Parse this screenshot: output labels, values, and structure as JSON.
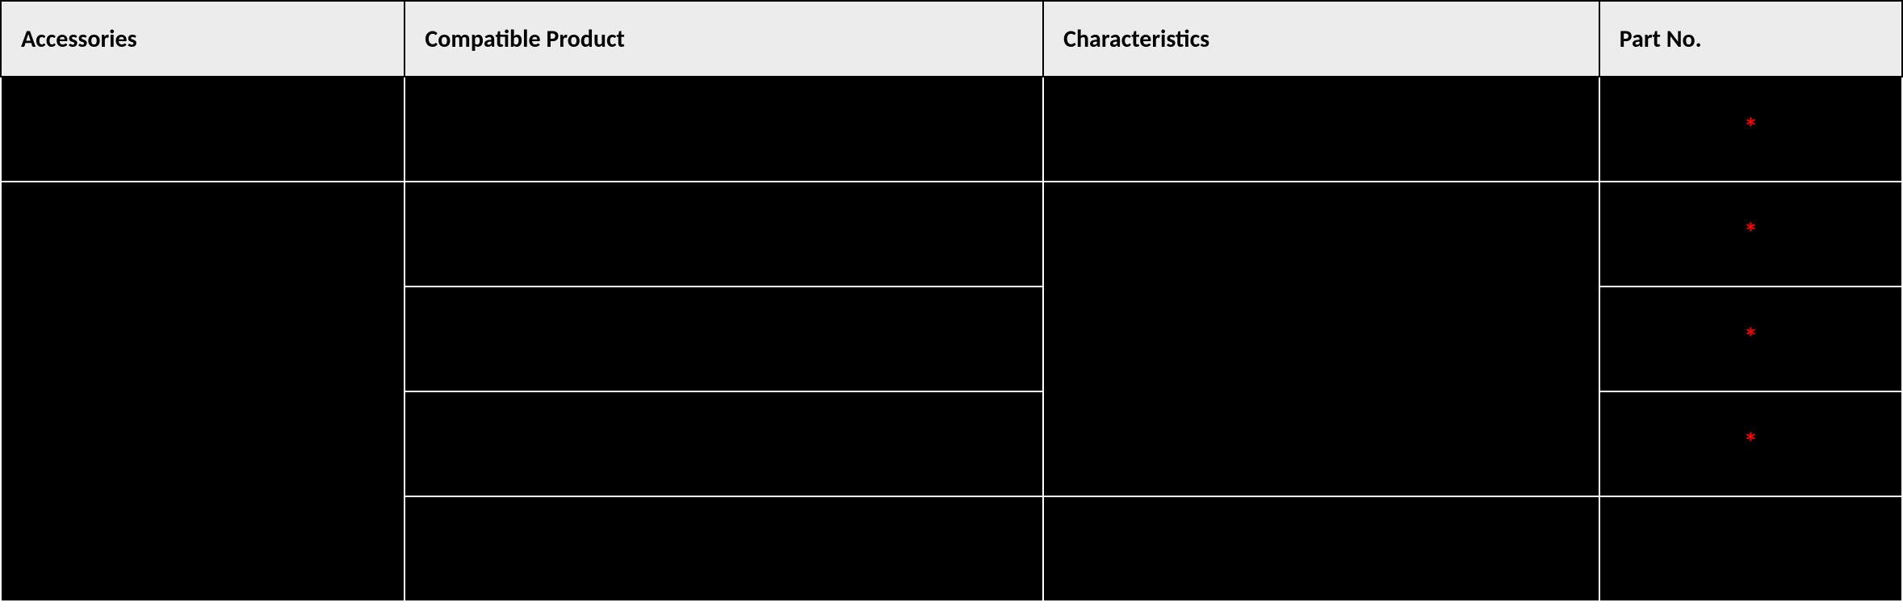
{
  "table": {
    "headers": {
      "accessories": "Accessories",
      "compatible_product": "Compatible Product",
      "characteristics": "Characteristics",
      "part_no": "Part No."
    },
    "asterisk": "*",
    "rows": [
      {
        "accessories": "",
        "compatible_product": "",
        "characteristics": "",
        "part_no": "",
        "part_no_marked": true,
        "accessories_rowspan": 1,
        "characteristics_rowspan": 1
      },
      {
        "accessories": "",
        "compatible_product": "",
        "characteristics": "",
        "part_no": "",
        "part_no_marked": true,
        "accessories_rowspan": 4,
        "characteristics_rowspan": 3
      },
      {
        "compatible_product": "",
        "part_no": "",
        "part_no_marked": true
      },
      {
        "compatible_product": "",
        "part_no": "",
        "part_no_marked": true
      },
      {
        "compatible_product": "",
        "characteristics": "",
        "part_no": "",
        "part_no_marked": false
      }
    ]
  }
}
